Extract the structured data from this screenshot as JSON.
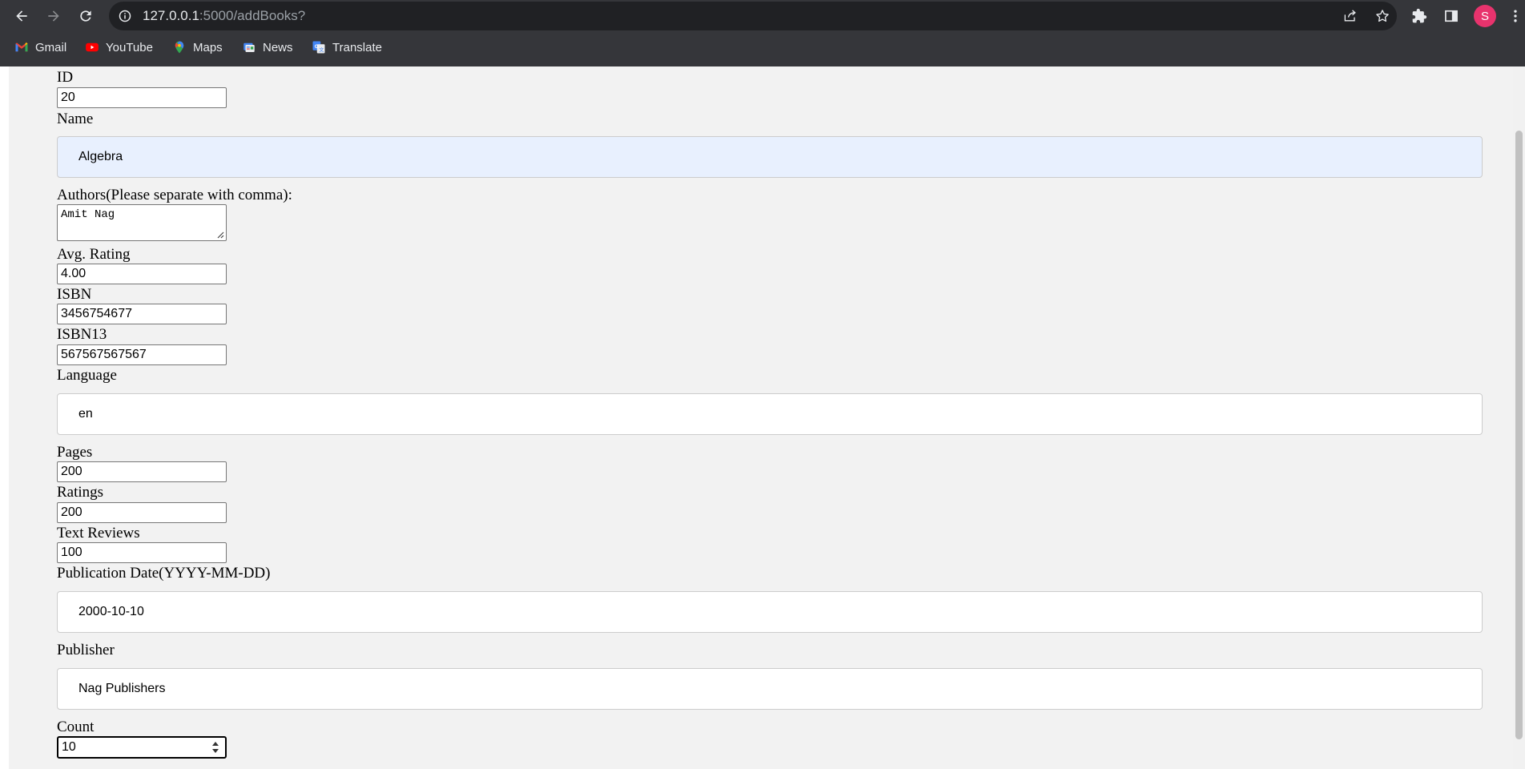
{
  "browser": {
    "url_host": "127.0.0.1",
    "url_path": ":5000/addBooks?",
    "avatar_letter": "S",
    "bookmarks": [
      {
        "label": "Gmail",
        "icon": "gmail-icon"
      },
      {
        "label": "YouTube",
        "icon": "youtube-icon"
      },
      {
        "label": "Maps",
        "icon": "maps-icon"
      },
      {
        "label": "News",
        "icon": "news-icon"
      },
      {
        "label": "Translate",
        "icon": "translate-icon"
      }
    ]
  },
  "form": {
    "id": {
      "label": "ID",
      "value": "20"
    },
    "name": {
      "label": "Name",
      "value": "Algebra"
    },
    "authors": {
      "label": "Authors(Please separate with comma):",
      "value": "Amit Nag"
    },
    "avg_rating": {
      "label": "Avg. Rating",
      "value": "4.00"
    },
    "isbn": {
      "label": "ISBN",
      "value": "3456754677"
    },
    "isbn13": {
      "label": "ISBN13",
      "value": "567567567567"
    },
    "language": {
      "label": "Language",
      "value": "en"
    },
    "pages": {
      "label": "Pages",
      "value": "200"
    },
    "ratings": {
      "label": "Ratings",
      "value": "200"
    },
    "text_reviews": {
      "label": "Text Reviews",
      "value": "100"
    },
    "publication_date": {
      "label": "Publication Date(YYYY-MM-DD)",
      "value": "2000-10-10"
    },
    "publisher": {
      "label": "Publisher",
      "value": "Nag Publishers"
    },
    "count": {
      "label": "Count",
      "value": "10"
    }
  },
  "colors": {
    "chrome_bg": "#35363a",
    "omnibox_bg": "#202124",
    "page_bg": "#f2f2f2",
    "autofill_bg": "#e8f0fe",
    "avatar_bg": "#e8336d"
  }
}
